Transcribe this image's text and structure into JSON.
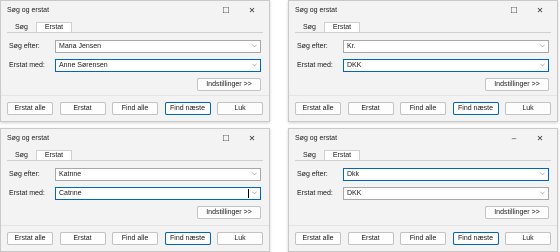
{
  "dialogs": [
    {
      "title": "Søg og erstat",
      "tabs": [
        "Søg",
        "Erstat"
      ],
      "find_label": "Søg efter:",
      "find_value": "Maria Jensen",
      "replace_label": "Erstat med:",
      "replace_value": "Anne Sørensen",
      "options_label": "Indstillinger >>",
      "buttons": [
        "Erstat alle",
        "Erstat",
        "Find alle",
        "Find næste",
        "Luk"
      ]
    },
    {
      "title": "Søg og erstat",
      "tabs": [
        "Søg",
        "Erstat"
      ],
      "find_label": "Søg efter:",
      "find_value": "Kr.",
      "replace_label": "Erstat med:",
      "replace_value": "DKK",
      "options_label": "Indstillinger >>",
      "buttons": [
        "Erstat alle",
        "Erstat",
        "Find alle",
        "Find næste",
        "Luk"
      ]
    },
    {
      "title": "Søg og erstat",
      "tabs": [
        "Søg",
        "Erstat"
      ],
      "find_label": "Søg efter:",
      "find_value": "Katrine",
      "replace_label": "Erstat med:",
      "replace_value": "Catrine",
      "options_label": "Indstillinger >>",
      "buttons": [
        "Erstat alle",
        "Erstat",
        "Find alle",
        "Find næste",
        "Luk"
      ]
    },
    {
      "title": "Søg og erstat",
      "tabs": [
        "Søg",
        "Erstat"
      ],
      "find_label": "Søg efter:",
      "find_value": "Dkk",
      "replace_label": "Erstat med:",
      "replace_value": "DKK",
      "options_label": "Indstillinger >>",
      "buttons": [
        "Erstat alle",
        "Erstat",
        "Find alle",
        "Find næste",
        "Luk"
      ]
    }
  ],
  "window_controls": {
    "minimize": "–",
    "maximize": "☐",
    "close": "✕",
    "dropdown_arrow": "⌵"
  },
  "icons": [
    "minimize-icon",
    "maximize-icon",
    "close-icon",
    "chevron-down-icon"
  ]
}
